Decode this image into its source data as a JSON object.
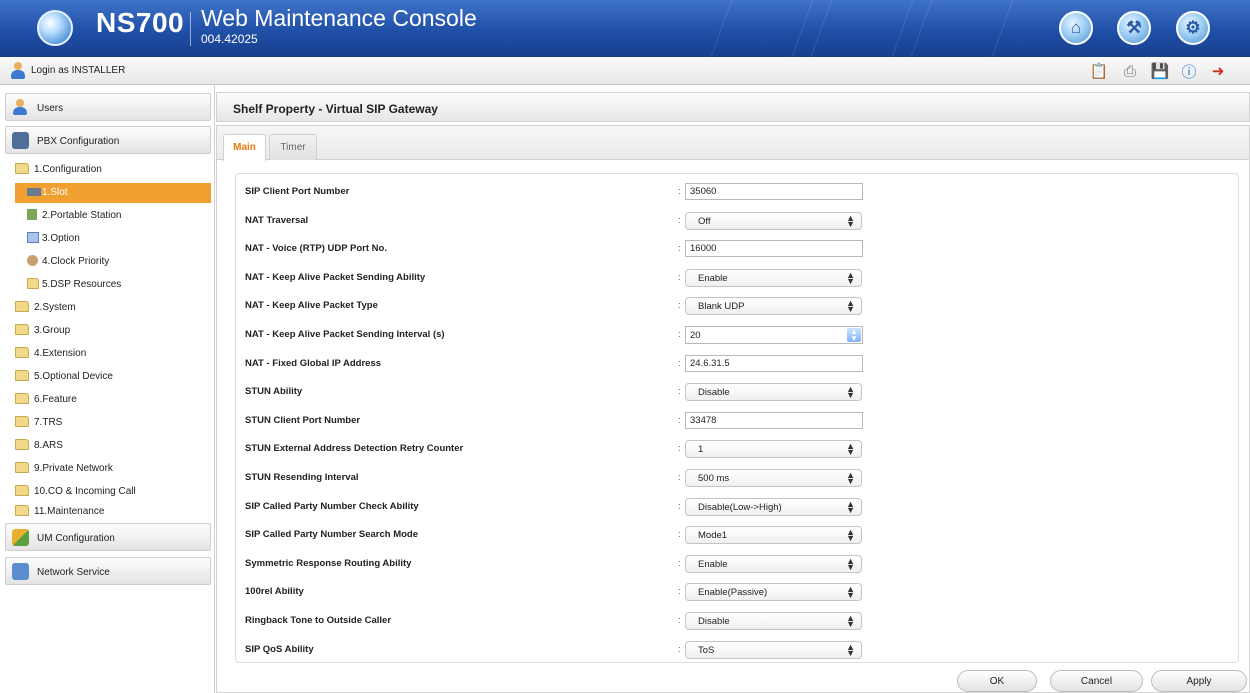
{
  "header": {
    "brand": "NS700",
    "title": "Web Maintenance Console",
    "version": "004.42025",
    "icons": [
      "home-icon",
      "maintenance-icon",
      "settings-icon"
    ]
  },
  "login_bar": {
    "text": "Login as INSTALLER",
    "tools": [
      "report-icon",
      "print-icon",
      "save-icon",
      "info-icon",
      "logout-icon"
    ]
  },
  "sidebar": {
    "users": "Users",
    "pbx_configuration": "PBX Configuration",
    "um_configuration": "UM Configuration",
    "network_service": "Network Service",
    "tree": [
      "1.Configuration",
      "1.Slot",
      "2.Portable Station",
      "3.Option",
      "4.Clock Priority",
      "5.DSP Resources",
      "2.System",
      "3.Group",
      "4.Extension",
      "5.Optional Device",
      "6.Feature",
      "7.TRS",
      "8.ARS",
      "9.Private Network",
      "10.CO & Incoming Call",
      "11.Maintenance"
    ],
    "selected_index": 1
  },
  "main": {
    "title": "Shelf Property - Virtual SIP Gateway",
    "tabs": [
      "Main",
      "Timer"
    ],
    "active_tab": "Main",
    "fields": [
      {
        "label": "SIP Client Port Number",
        "type": "text",
        "value": "35060"
      },
      {
        "label": "NAT Traversal",
        "type": "select",
        "value": "Off"
      },
      {
        "label": "NAT - Voice (RTP) UDP Port No.",
        "type": "text",
        "value": "16000"
      },
      {
        "label": "NAT - Keep Alive Packet Sending Ability",
        "type": "select",
        "value": "Enable"
      },
      {
        "label": "NAT - Keep Alive Packet Type",
        "type": "select",
        "value": "Blank UDP"
      },
      {
        "label": "NAT - Keep Alive Packet Sending Interval (s)",
        "type": "spin",
        "value": "20"
      },
      {
        "label": "NAT - Fixed Global IP Address",
        "type": "text",
        "value": "24.6.31.5"
      },
      {
        "label": "STUN Ability",
        "type": "select",
        "value": "Disable"
      },
      {
        "label": "STUN Client Port Number",
        "type": "text",
        "value": "33478"
      },
      {
        "label": "STUN External Address Detection Retry Counter",
        "type": "select",
        "value": "1"
      },
      {
        "label": "STUN Resending Interval",
        "type": "select",
        "value": "500 ms"
      },
      {
        "label": "SIP Called Party Number Check Ability",
        "type": "select",
        "value": "Disable(Low->High)"
      },
      {
        "label": "SIP Called Party Number Search Mode",
        "type": "select",
        "value": "Mode1"
      },
      {
        "label": "Symmetric Response Routing Ability",
        "type": "select",
        "value": "Enable"
      },
      {
        "label": "100rel Ability",
        "type": "select",
        "value": "Enable(Passive)"
      },
      {
        "label": "Ringback Tone to Outside Caller",
        "type": "select",
        "value": "Disable"
      },
      {
        "label": "SIP QoS Ability",
        "type": "select",
        "value": "ToS"
      }
    ]
  },
  "buttons": {
    "ok": "OK",
    "cancel": "Cancel",
    "apply": "Apply"
  }
}
